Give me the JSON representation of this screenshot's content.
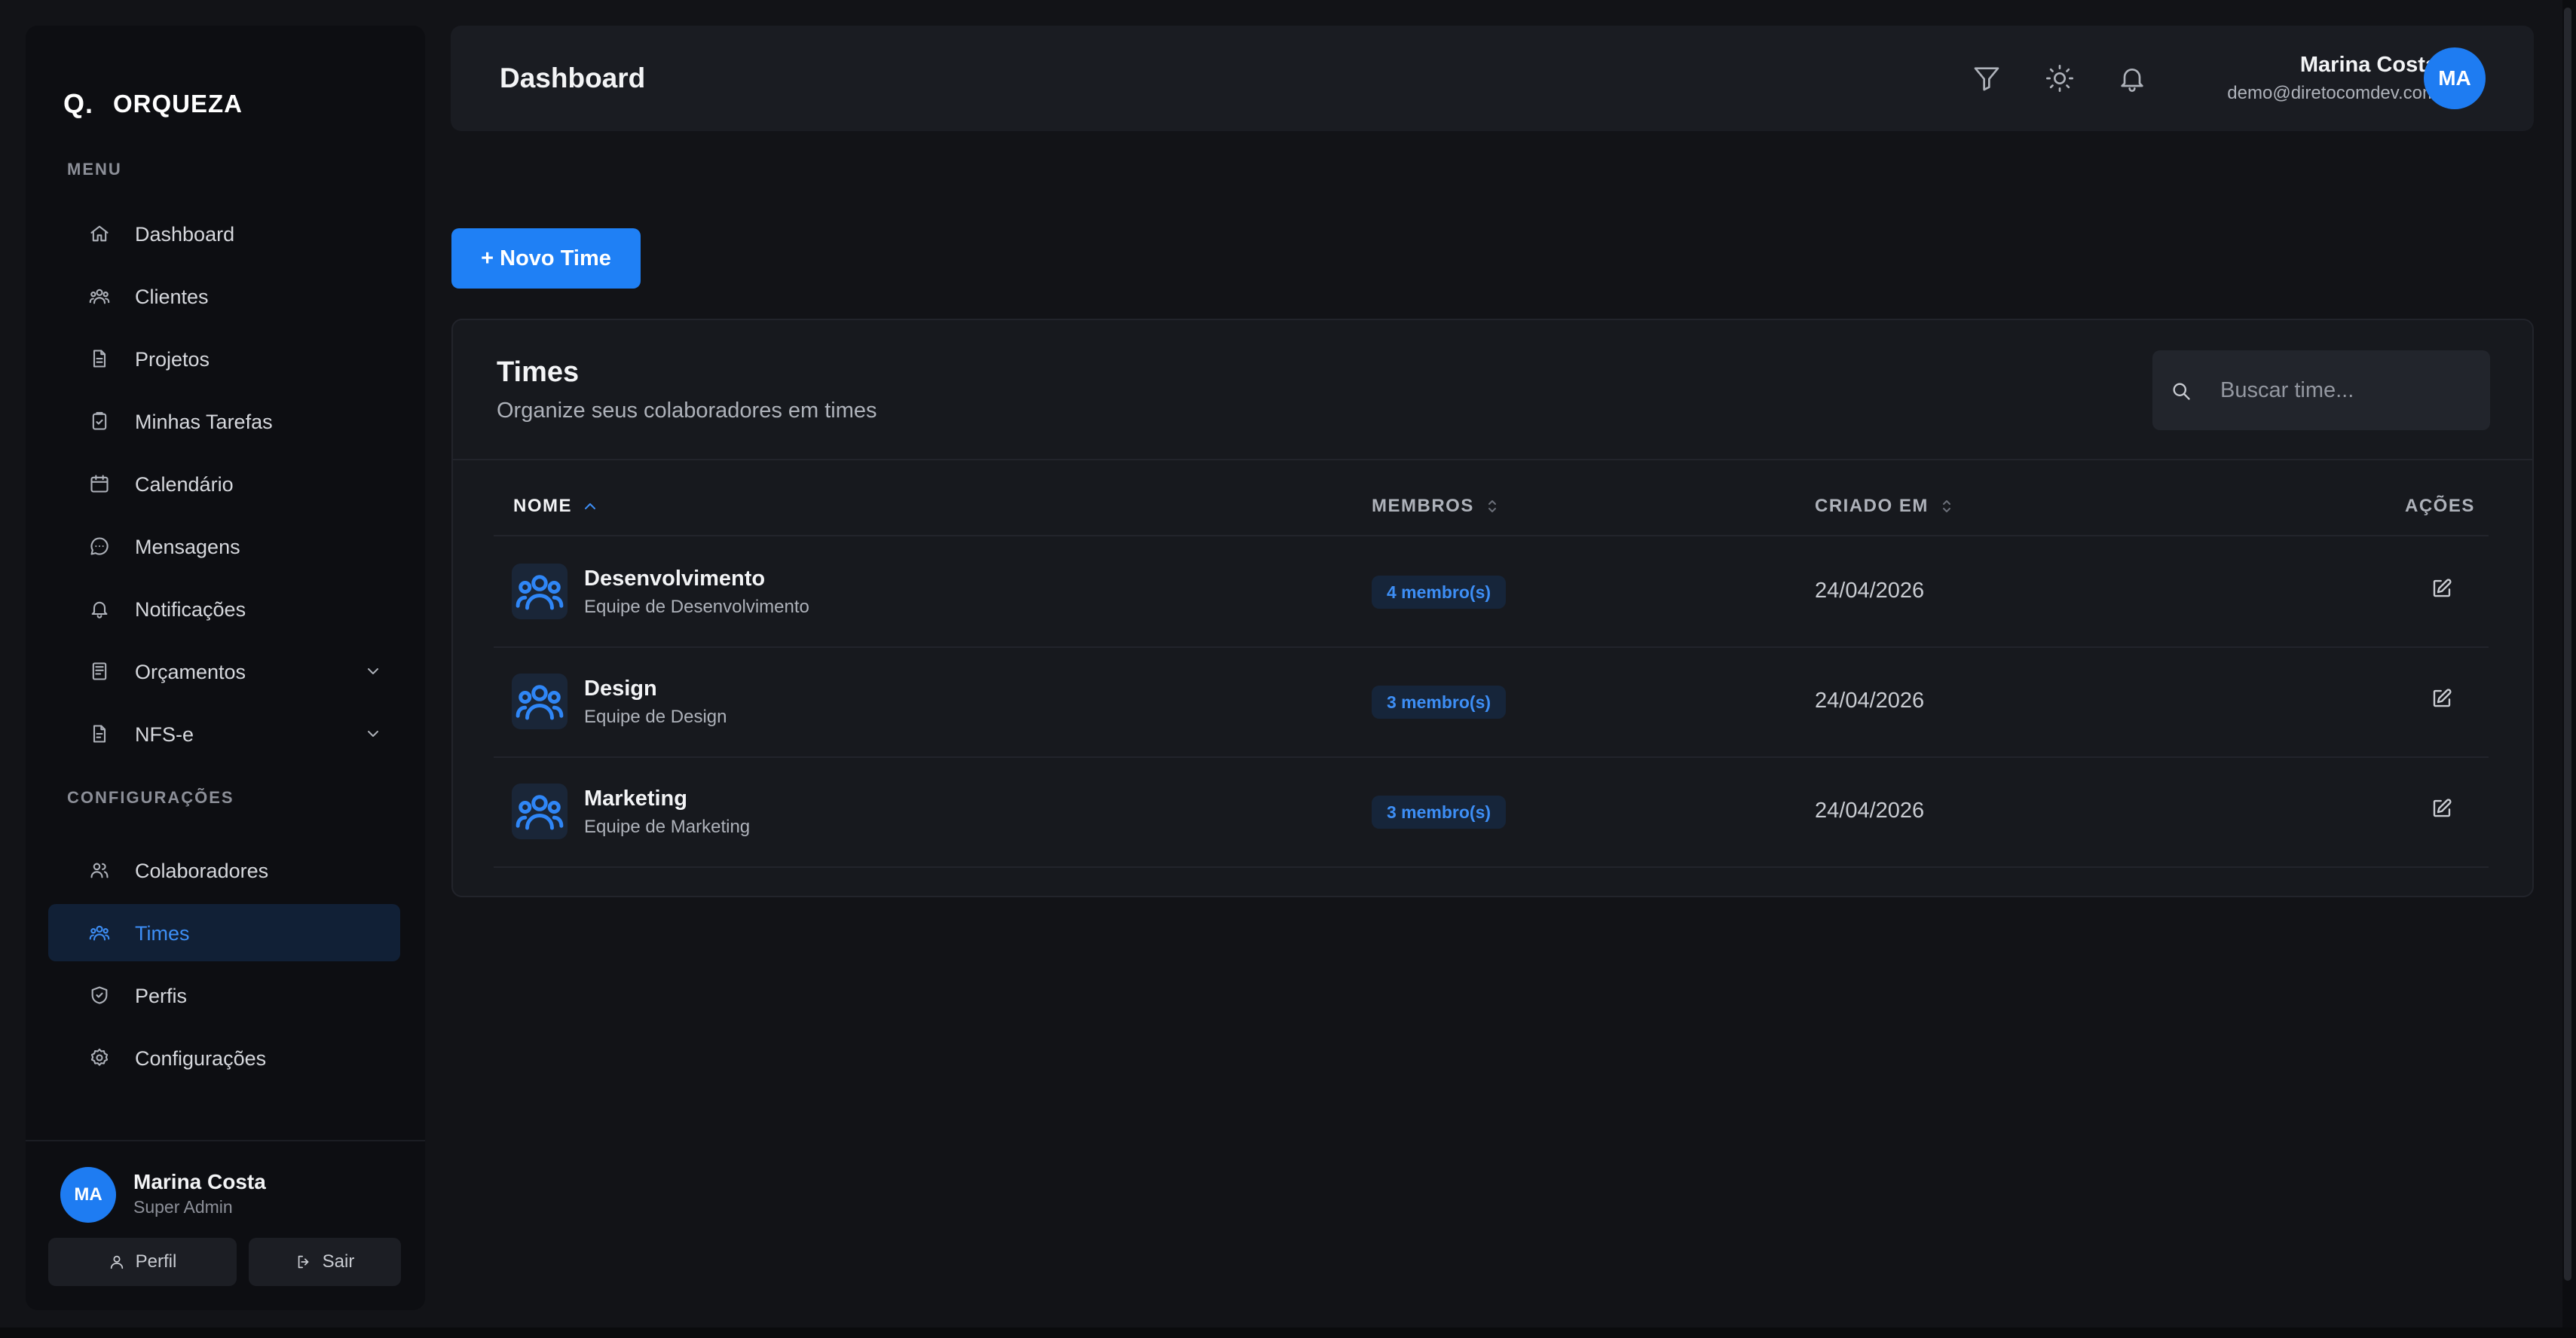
{
  "brand": {
    "mark": "Q.",
    "name": "ORQUEZA"
  },
  "sidebar": {
    "menu_label": "MENU",
    "settings_label": "CONFIGURAÇÕES",
    "items": [
      {
        "label": "Dashboard",
        "icon": "home-icon"
      },
      {
        "label": "Clientes",
        "icon": "users-icon"
      },
      {
        "label": "Projetos",
        "icon": "file-icon"
      },
      {
        "label": "Minhas Tarefas",
        "icon": "clipboard-check-icon"
      },
      {
        "label": "Calendário",
        "icon": "calendar-icon"
      },
      {
        "label": "Mensagens",
        "icon": "message-icon"
      },
      {
        "label": "Notificações",
        "icon": "bell-icon"
      },
      {
        "label": "Orçamentos",
        "icon": "receipt-icon"
      },
      {
        "label": "NFS-e",
        "icon": "document-icon"
      }
    ],
    "settings_items": [
      {
        "label": "Colaboradores",
        "icon": "user-group-icon"
      },
      {
        "label": "Times",
        "icon": "team-icon",
        "active": true
      },
      {
        "label": "Perfis",
        "icon": "shield-icon"
      },
      {
        "label": "Configurações",
        "icon": "gear-icon"
      }
    ],
    "user": {
      "initials": "MA",
      "name": "Marina Costa",
      "role": "Super Admin"
    },
    "profile_button": "Perfil",
    "logout_button": "Sair"
  },
  "header": {
    "title": "Dashboard",
    "user": {
      "name": "Marina Costa",
      "email": "demo@diretocomdev.com",
      "initials": "MA"
    }
  },
  "main": {
    "new_button": "+ Novo Time",
    "card": {
      "title": "Times",
      "subtitle": "Organize seus colaboradores em times",
      "search_placeholder": "Buscar time...",
      "columns": {
        "name": "NOME",
        "members": "MEMBROS",
        "created": "CRIADO EM",
        "actions": "AÇÕES"
      },
      "rows": [
        {
          "name": "Desenvolvimento",
          "description": "Equipe de Desenvolvimento",
          "members": "4 membro(s)",
          "created": "24/04/2026"
        },
        {
          "name": "Design",
          "description": "Equipe de Design",
          "members": "3 membro(s)",
          "created": "24/04/2026"
        },
        {
          "name": "Marketing",
          "description": "Equipe de Marketing",
          "members": "3 membro(s)",
          "created": "24/04/2026"
        }
      ]
    }
  },
  "colors": {
    "accent": "#1f80f5",
    "background": "#121317",
    "sidebar": "#0d0e12",
    "card": "#17191e"
  }
}
